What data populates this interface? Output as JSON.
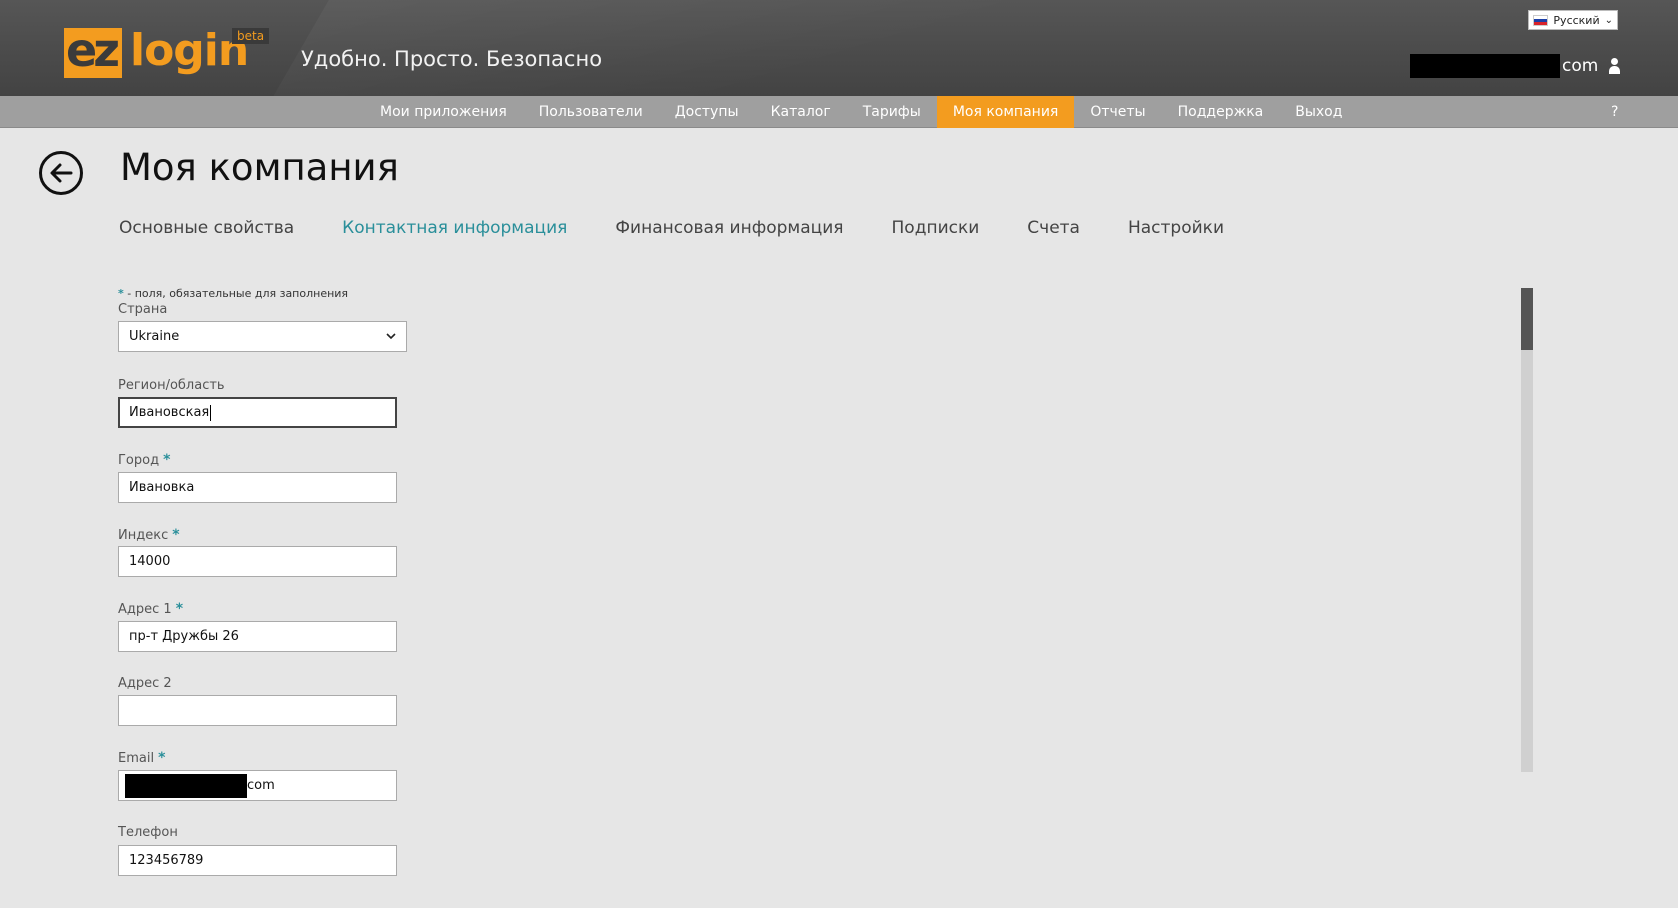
{
  "header": {
    "logo": {
      "mark": "ez",
      "wordmark": "login",
      "badge": "beta"
    },
    "tagline": "Удобно. Просто. Безопасно",
    "language": {
      "selected": "Русский"
    },
    "user": {
      "email_suffix": "com"
    }
  },
  "nav": {
    "items": [
      {
        "label": "Мои приложения",
        "active": false
      },
      {
        "label": "Пользователи",
        "active": false
      },
      {
        "label": "Доступы",
        "active": false
      },
      {
        "label": "Каталог",
        "active": false
      },
      {
        "label": "Тарифы",
        "active": false
      },
      {
        "label": "Моя компания",
        "active": true
      },
      {
        "label": "Отчеты",
        "active": false
      },
      {
        "label": "Поддержка",
        "active": false
      },
      {
        "label": "Выход",
        "active": false
      }
    ],
    "help": "?"
  },
  "page": {
    "title": "Моя компания",
    "tabs": [
      {
        "label": "Основные свойства",
        "active": false
      },
      {
        "label": "Контактная информация",
        "active": true
      },
      {
        "label": "Финансовая информация",
        "active": false
      },
      {
        "label": "Подписки",
        "active": false
      },
      {
        "label": "Счета",
        "active": false
      },
      {
        "label": "Настройки",
        "active": false
      }
    ]
  },
  "form": {
    "required_note_star": "*",
    "required_note": " - поля, обязательные для заполнения",
    "required_mark": "*",
    "fields": {
      "country": {
        "label": "Страна",
        "value": "Ukraine"
      },
      "region": {
        "label": "Регион/область",
        "value": "Ивановская"
      },
      "city": {
        "label": "Город",
        "value": "Ивановка"
      },
      "zip": {
        "label": "Индекс",
        "value": "14000"
      },
      "address1": {
        "label": "Адрес 1",
        "value": "пр-т Дружбы 26"
      },
      "address2": {
        "label": "Адрес 2",
        "value": ""
      },
      "email": {
        "label": "Email",
        "value_suffix": "com"
      },
      "phone": {
        "label": "Телефон",
        "value": "123456789"
      }
    }
  },
  "colors": {
    "accent": "#f39c1f",
    "active_tab": "#2a8f9a",
    "nav_bg": "#9f9f9f",
    "header_bg": "#4b4b4b",
    "page_bg": "#e6e6e6"
  },
  "icons": [
    "back-arrow-icon",
    "user-icon",
    "chevron-down-icon",
    "flag-ru-icon"
  ]
}
